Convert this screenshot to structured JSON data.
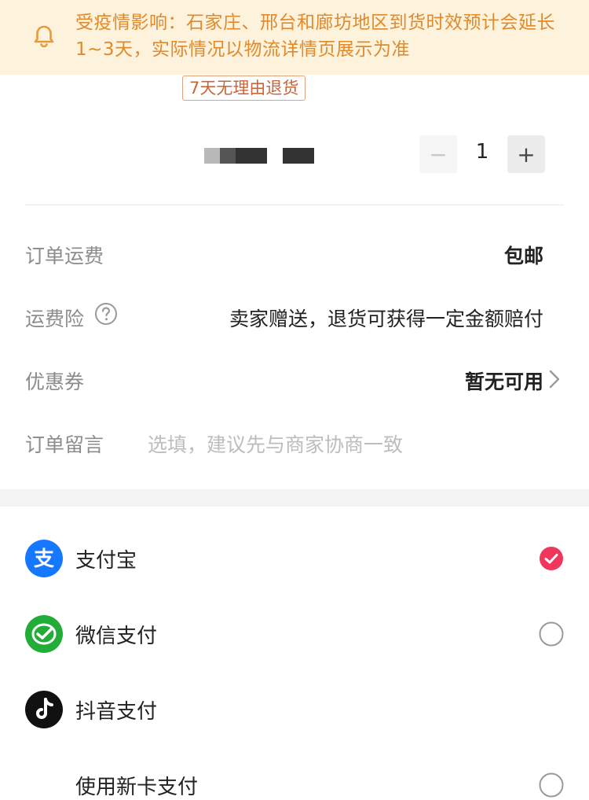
{
  "notice": {
    "icon": "bell-icon",
    "text": "受疫情影响：石家庄、邢台和廊坊地区到货时效预计会延长1~3天，实际情况以物流详情页展示为准",
    "color": "#e08a2c"
  },
  "product": {
    "tag": "7天无理由退货",
    "quantity": "1",
    "minus_label": "−",
    "plus_label": "+"
  },
  "order": {
    "shipping_label": "订单运费",
    "shipping_value": "包邮",
    "insurance_label": "运费险",
    "insurance_value": "卖家赠送，退货可获得一定金额赔付",
    "coupon_label": "优惠券",
    "coupon_value": "暂无可用",
    "message_label": "订单留言",
    "message_placeholder": "选填，建议先与商家协商一致"
  },
  "payment": {
    "methods": [
      {
        "label": "支付宝",
        "icon": "alipay-icon",
        "selected": true
      },
      {
        "label": "微信支付",
        "icon": "wechat-pay-icon",
        "selected": false
      },
      {
        "label": "抖音支付",
        "icon": "douyin-pay-icon",
        "selected": false
      },
      {
        "label": "使用新卡支付",
        "icon": "",
        "selected": false
      }
    ],
    "selected_color": "#f0365a"
  }
}
